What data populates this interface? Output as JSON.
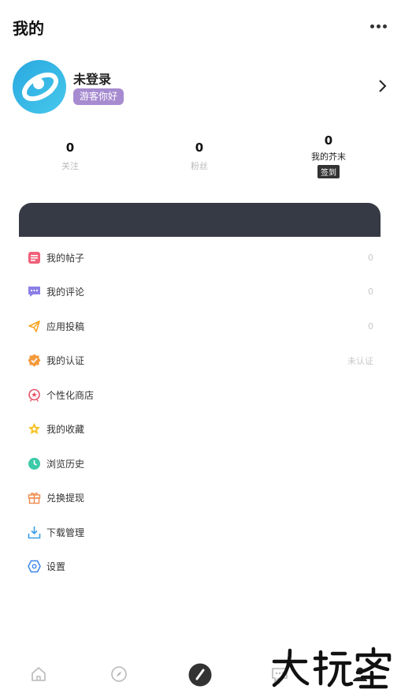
{
  "header": {
    "title": "我的"
  },
  "profile": {
    "name": "未登录",
    "badge": "游客你好"
  },
  "stats": [
    {
      "value": "0",
      "label": "关注"
    },
    {
      "value": "0",
      "label": "粉丝"
    },
    {
      "value": "0",
      "label": "我的芥末",
      "action": "签到"
    }
  ],
  "menu": [
    {
      "label": "我的帖子",
      "value": "0",
      "icon": "post-icon"
    },
    {
      "label": "我的评论",
      "value": "0",
      "icon": "comment-icon"
    },
    {
      "label": "应用投稿",
      "value": "0",
      "icon": "submit-app-icon"
    },
    {
      "label": "我的认证",
      "value": "未认证",
      "icon": "verify-icon"
    },
    {
      "label": "个性化商店",
      "value": "",
      "icon": "store-icon"
    },
    {
      "label": "我的收藏",
      "value": "",
      "icon": "favorite-icon"
    },
    {
      "label": "浏览历史",
      "value": "",
      "icon": "history-icon"
    },
    {
      "label": "兑换提现",
      "value": "",
      "icon": "gift-icon"
    },
    {
      "label": "下载管理",
      "value": "",
      "icon": "download-icon"
    },
    {
      "label": "设置",
      "value": "",
      "icon": "settings-icon"
    }
  ],
  "tabs": [
    "home-icon",
    "discover-icon",
    "publish-icon",
    "message-icon",
    "profile-icon"
  ],
  "colors": {
    "badge": "#a78bd0",
    "card": "#353a44",
    "accent": "#2aa8e0"
  }
}
